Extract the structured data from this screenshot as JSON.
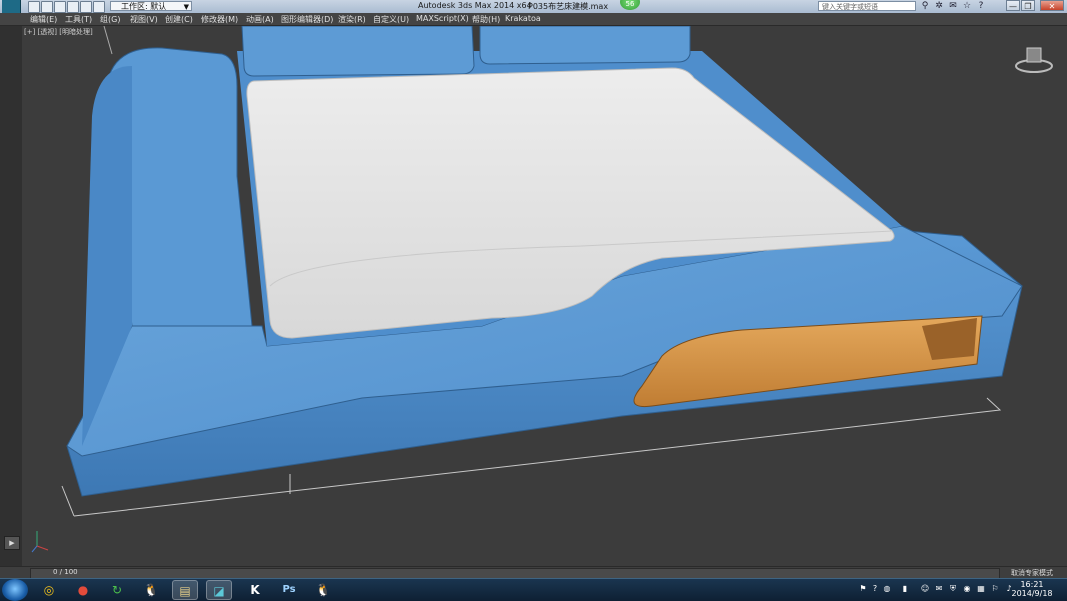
{
  "titlebar": {
    "workspace_label": "工作区: 默认",
    "app_title": "Autodesk 3ds Max  2014 x64",
    "file_title": "P035布艺床建模.max",
    "badge": "56",
    "search_placeholder": "键入关键字或短语",
    "window_buttons": {
      "minimize": "—",
      "restore": "❐",
      "close": "✕"
    }
  },
  "menubar": {
    "items": [
      "编辑(E)",
      "工具(T)",
      "组(G)",
      "视图(V)",
      "创建(C)",
      "修改器(M)",
      "动画(A)",
      "图形编辑器(D)",
      "渲染(R)",
      "自定义(U)",
      "MAXScript(X)",
      "帮助(H)",
      "Krakatoa"
    ]
  },
  "viewport": {
    "label": "[+] [透视] [明暗处理]"
  },
  "statusbar": {
    "frame_counter": "0 / 100",
    "message": "取消专家模式"
  },
  "taskbar": {
    "apps": [
      {
        "icon": "360-icon",
        "glyph": "◎"
      },
      {
        "icon": "chrome-icon",
        "glyph": "●"
      },
      {
        "icon": "green-app-icon",
        "glyph": "↻"
      },
      {
        "icon": "qq-penguin-icon",
        "glyph": "🐧"
      },
      {
        "icon": "folder-icon",
        "glyph": "▤"
      },
      {
        "icon": "3dsmax-icon",
        "glyph": "◪"
      },
      {
        "icon": "k-app-icon",
        "glyph": "K"
      },
      {
        "icon": "photoshop-icon",
        "glyph": "Ps"
      },
      {
        "icon": "qq-penguin-icon",
        "glyph": "🐧"
      }
    ],
    "clock_time": "16:21",
    "clock_date": "2014/9/18"
  },
  "colors": {
    "bed_blue": "#4d8fce",
    "mattress_white": "#f2f2f2",
    "drawer_orange": "#d89446",
    "viewport_bg": "#3c3c3c"
  }
}
